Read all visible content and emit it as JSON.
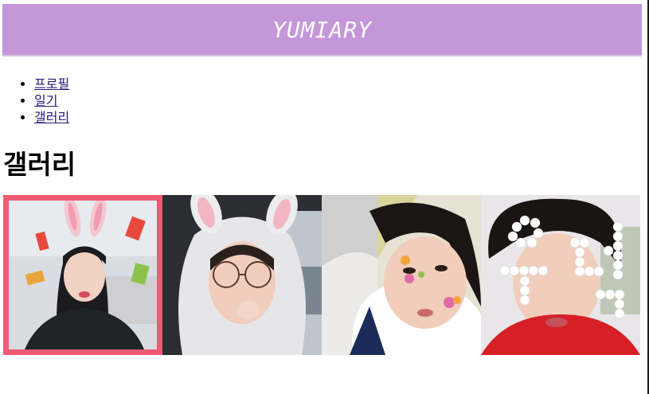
{
  "header": {
    "title": "YUMIARY"
  },
  "nav": {
    "items": [
      {
        "label": "프로필"
      },
      {
        "label": "일기"
      },
      {
        "label": "갤러리"
      }
    ]
  },
  "page_title": "갤러리",
  "gallery": {
    "photos": [
      {
        "icon": "selfie-bunny-ears-photo",
        "selected": true
      },
      {
        "icon": "selfie-bunny-hood-glasses-photo",
        "selected": false
      },
      {
        "icon": "selfie-fruit-stickers-photo",
        "selected": false
      },
      {
        "icon": "selfie-heart-letters-photo",
        "selected": false
      }
    ]
  },
  "colors": {
    "header_bg": "#c497d9",
    "selected_border": "#f05a72",
    "link": "#2a1a7a"
  }
}
